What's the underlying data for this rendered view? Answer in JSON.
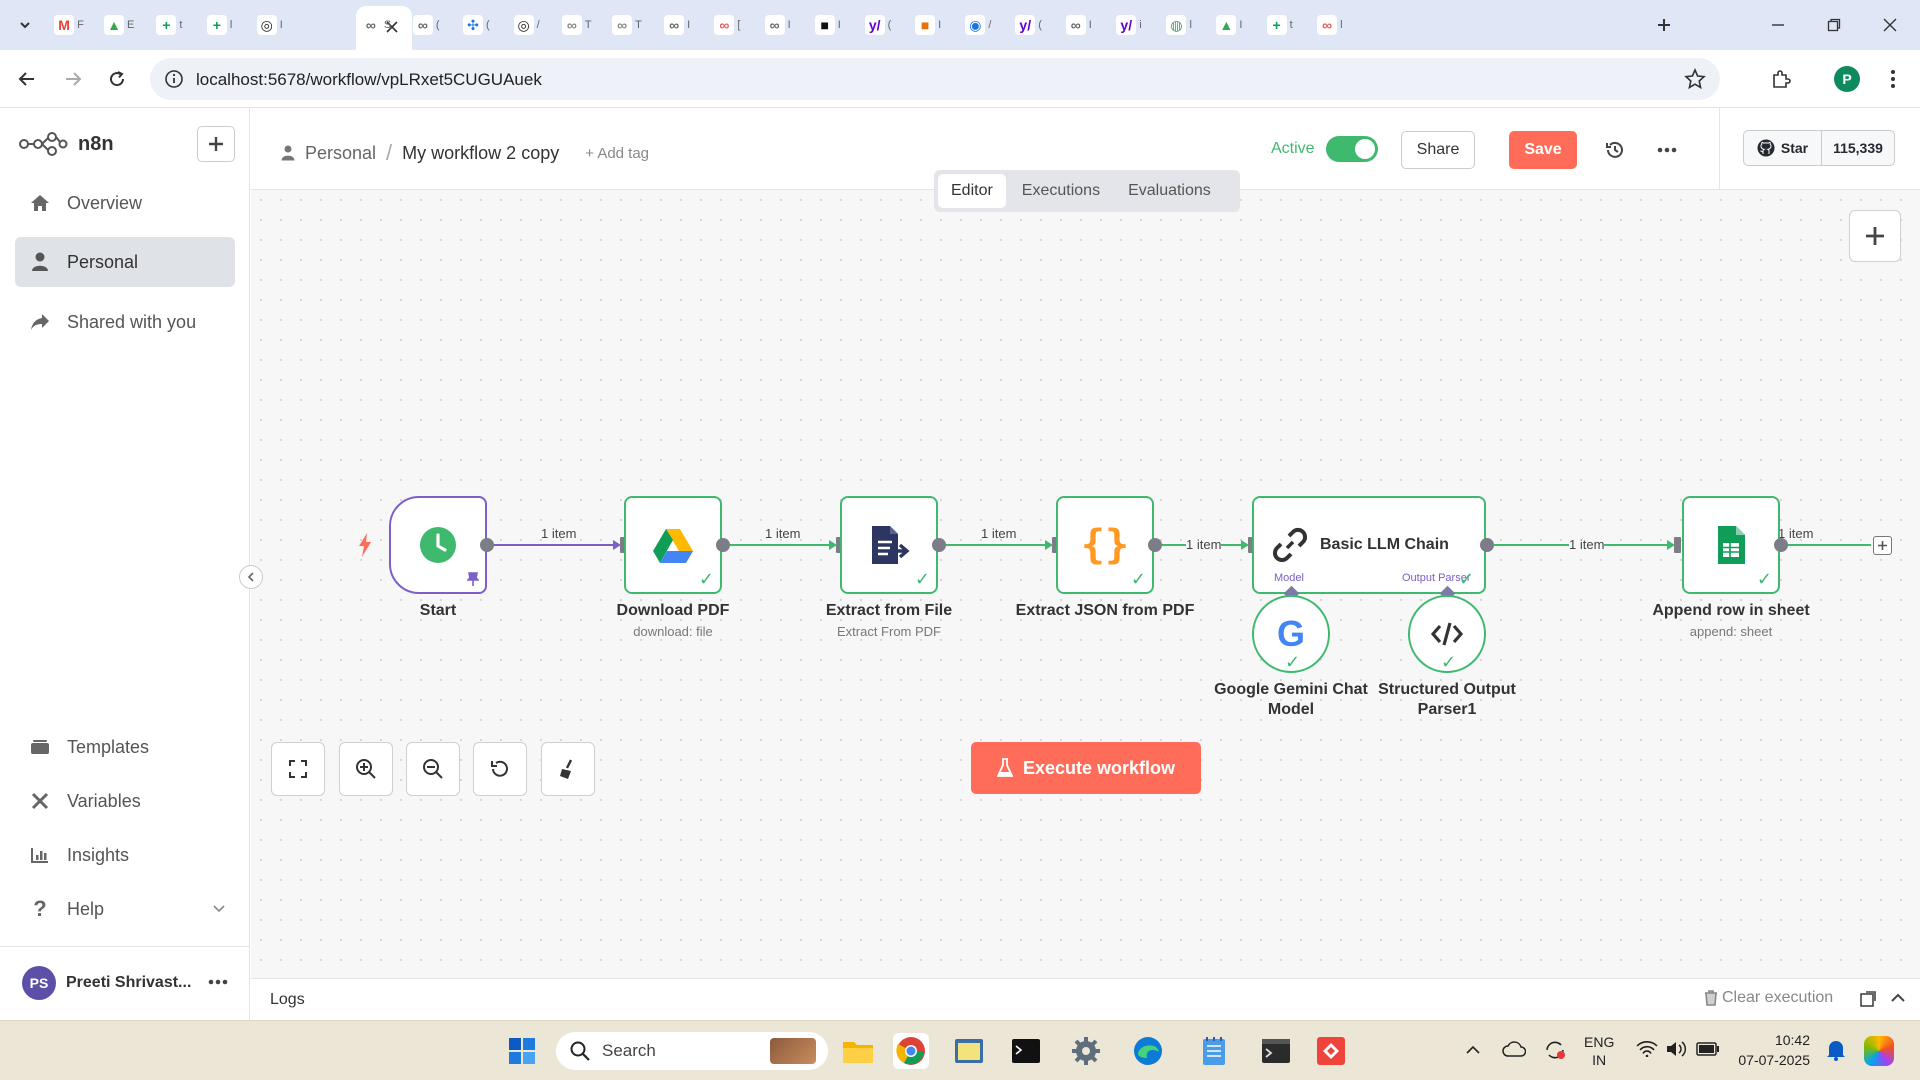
{
  "browser": {
    "url": "localhost:5678/workflow/vpLRxet5CUGUAuek",
    "tabs": [
      {
        "icon": "gmail-icon",
        "letter": "M",
        "color": "#ea4335",
        "title": "F"
      },
      {
        "icon": "drive-icon",
        "letter": "▲",
        "color": "#34a853",
        "title": "E"
      },
      {
        "icon": "sheets-icon",
        "letter": "+",
        "color": "#0f9d58",
        "title": "t"
      },
      {
        "icon": "sheets-icon",
        "letter": "+",
        "color": "#0f9d58",
        "title": "l"
      },
      {
        "icon": "openai-icon",
        "letter": "◎",
        "color": "#222222",
        "title": "I"
      },
      {
        "icon": "n8n-icon",
        "letter": "∞",
        "color": "#666666",
        "title": "S"
      },
      {
        "icon": "n8n-icon",
        "letter": "∞",
        "color": "#666666",
        "title": "("
      },
      {
        "icon": "extension-icon",
        "letter": "✣",
        "color": "#1a73e8",
        "title": "("
      },
      {
        "icon": "openai-icon",
        "letter": "◎",
        "color": "#222222",
        "title": "/"
      },
      {
        "icon": "n8n-icon",
        "letter": "∞",
        "color": "#888888",
        "title": "T"
      },
      {
        "icon": "n8n-icon",
        "letter": "∞",
        "color": "#888888",
        "title": "T"
      },
      {
        "icon": "n8n-icon",
        "letter": "∞",
        "color": "#666666",
        "title": "I"
      },
      {
        "icon": "n8n-icon",
        "letter": "∞",
        "color": "#e35b5b",
        "title": "["
      },
      {
        "icon": "n8n-icon",
        "letter": "∞",
        "color": "#666666",
        "title": "I"
      },
      {
        "icon": "app-icon",
        "letter": "■",
        "color": "#111111",
        "title": "I"
      },
      {
        "icon": "yahoo-icon",
        "letter": "y/",
        "color": "#6001d2",
        "title": "("
      },
      {
        "icon": "app-icon",
        "letter": "■",
        "color": "#e8710a",
        "title": "I"
      },
      {
        "icon": "app-icon",
        "letter": "◉",
        "color": "#1a73e8",
        "title": "/"
      },
      {
        "icon": "yahoo-icon",
        "letter": "y/",
        "color": "#6001d2",
        "title": "("
      },
      {
        "icon": "n8n-icon",
        "letter": "∞",
        "color": "#666666",
        "title": "I"
      },
      {
        "icon": "yahoo-icon",
        "letter": "y/",
        "color": "#6001d2",
        "title": "i"
      },
      {
        "icon": "app-icon",
        "letter": "◍",
        "color": "#34a853",
        "title": "l"
      },
      {
        "icon": "drive-icon",
        "letter": "▲",
        "color": "#34a853",
        "title": "I"
      },
      {
        "icon": "sheets-icon",
        "letter": "+",
        "color": "#0f9d58",
        "title": "t"
      },
      {
        "icon": "n8n-icon",
        "letter": "∞",
        "color": "#e35b5b",
        "title": "l"
      }
    ]
  },
  "app": {
    "logo_text": "n8n",
    "sidebar": {
      "items": [
        {
          "label": "Overview",
          "icon": "home-icon"
        },
        {
          "label": "Personal",
          "icon": "user-icon"
        },
        {
          "label": "Shared with you",
          "icon": "share-icon"
        }
      ],
      "bottom_items": [
        {
          "label": "Templates",
          "icon": "templates-icon"
        },
        {
          "label": "Variables",
          "icon": "variables-icon"
        },
        {
          "label": "Insights",
          "icon": "insights-icon"
        },
        {
          "label": "Help",
          "icon": "help-icon"
        }
      ],
      "user": {
        "initials": "PS",
        "name": "Preeti Shrivast..."
      }
    },
    "header": {
      "breadcrumb_project": "Personal",
      "breadcrumb_sep": "/",
      "workflow_name": "My workflow 2 copy",
      "add_tag": "+ Add tag",
      "active_label": "Active",
      "share_label": "Share",
      "save_label": "Save",
      "star_label": "Star",
      "star_count": "115,339"
    },
    "tabs": [
      {
        "label": "Editor",
        "active": true
      },
      {
        "label": "Executions",
        "active": false
      },
      {
        "label": "Evaluations",
        "active": false
      }
    ],
    "nodes": {
      "start": {
        "title": "Start"
      },
      "download": {
        "title": "Download PDF",
        "subtitle": "download: file"
      },
      "extract_file": {
        "title": "Extract from File",
        "subtitle": "Extract From PDF"
      },
      "extract_json": {
        "title": "Extract JSON from PDF"
      },
      "llm": {
        "title": "Basic LLM Chain",
        "model_label": "Model",
        "parser_label": "Output Parser"
      },
      "gemini": {
        "title_line1": "Google Gemini Chat",
        "title_line2": "Model"
      },
      "parser": {
        "title_line1": "Structured Output",
        "title_line2": "Parser1"
      },
      "append": {
        "title": "Append row in sheet",
        "subtitle": "append: sheet"
      }
    },
    "edges": {
      "item_label": "1 item"
    },
    "execute_label": "Execute workflow",
    "logs_label": "Logs",
    "clear_execution_label": "Clear execution",
    "colors": {
      "accent": "#ff6d5a",
      "success": "#3fb96e",
      "trigger": "#7c5fc9",
      "active_toggle": "#3fb96e"
    }
  },
  "taskbar": {
    "search_placeholder": "Search",
    "lang_line1": "ENG",
    "lang_line2": "IN",
    "time": "10:42",
    "date": "07-07-2025"
  }
}
